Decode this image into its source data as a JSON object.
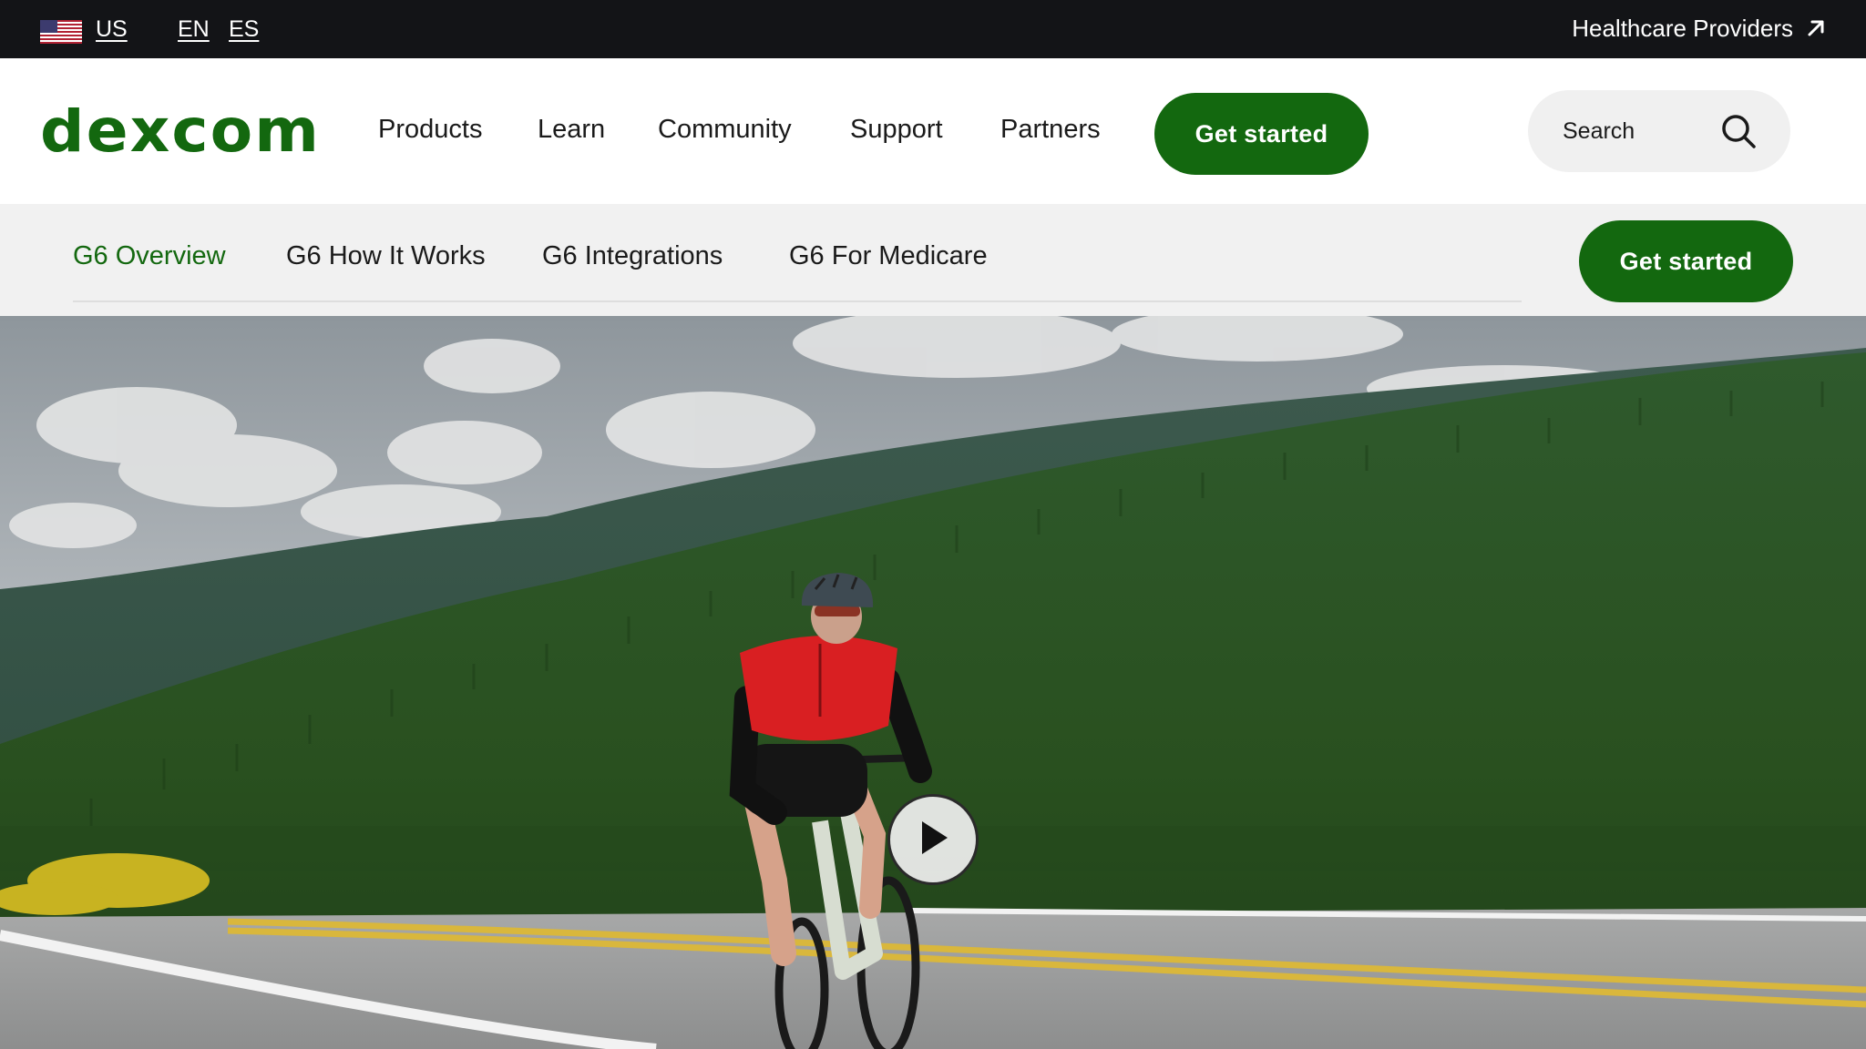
{
  "utility_bar": {
    "region": "US",
    "languages": [
      "EN",
      "ES"
    ],
    "healthcare_link": "Healthcare Providers",
    "flag_icon": "us-flag-icon",
    "arrow_icon": "arrow-up-right-icon"
  },
  "header": {
    "logo_text": "dexcom",
    "nav": [
      "Products",
      "Learn",
      "Community",
      "Support",
      "Partners"
    ],
    "cta_label": "Get started",
    "search_placeholder": "Search",
    "search_icon": "search-icon"
  },
  "sub_nav": {
    "items": [
      "G6 Overview",
      "G6 How It Works",
      "G6 Integrations",
      "G6 For Medicare"
    ],
    "active": "G6 Overview",
    "cta_label": "Get started"
  },
  "hero": {
    "play_icon": "play-icon"
  },
  "colors": {
    "brand_green": "#13680f",
    "top_bar": "#131417",
    "sub_nav_bg": "#f1f1f1",
    "search_bg": "#f0f0f0"
  }
}
